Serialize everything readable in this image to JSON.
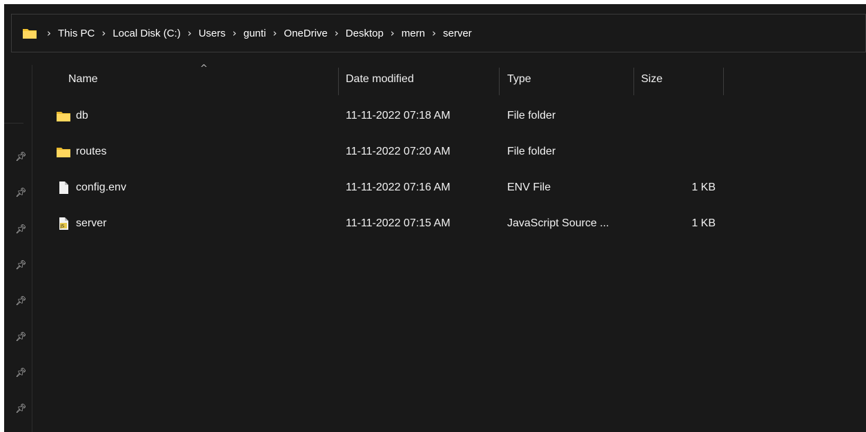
{
  "breadcrumb": {
    "items": [
      "This PC",
      "Local Disk (C:)",
      "Users",
      "gunti",
      "OneDrive",
      "Desktop",
      "mern",
      "server"
    ]
  },
  "columns": {
    "name": "Name",
    "date": "Date modified",
    "type": "Type",
    "size": "Size"
  },
  "files": [
    {
      "name": "db",
      "date": "11-11-2022 07:18 AM",
      "type": "File folder",
      "size": "",
      "icon": "folder-icon"
    },
    {
      "name": "routes",
      "date": "11-11-2022 07:20 AM",
      "type": "File folder",
      "size": "",
      "icon": "folder-icon"
    },
    {
      "name": "config.env",
      "date": "11-11-2022 07:16 AM",
      "type": "ENV File",
      "size": "1 KB",
      "icon": "file-icon"
    },
    {
      "name": "server",
      "date": "11-11-2022 07:15 AM",
      "type": "JavaScript Source ...",
      "size": "1 KB",
      "icon": "js-file-icon"
    }
  ],
  "colors": {
    "background": "#191919",
    "folder": "#f4c430",
    "text": "#ffffff"
  }
}
